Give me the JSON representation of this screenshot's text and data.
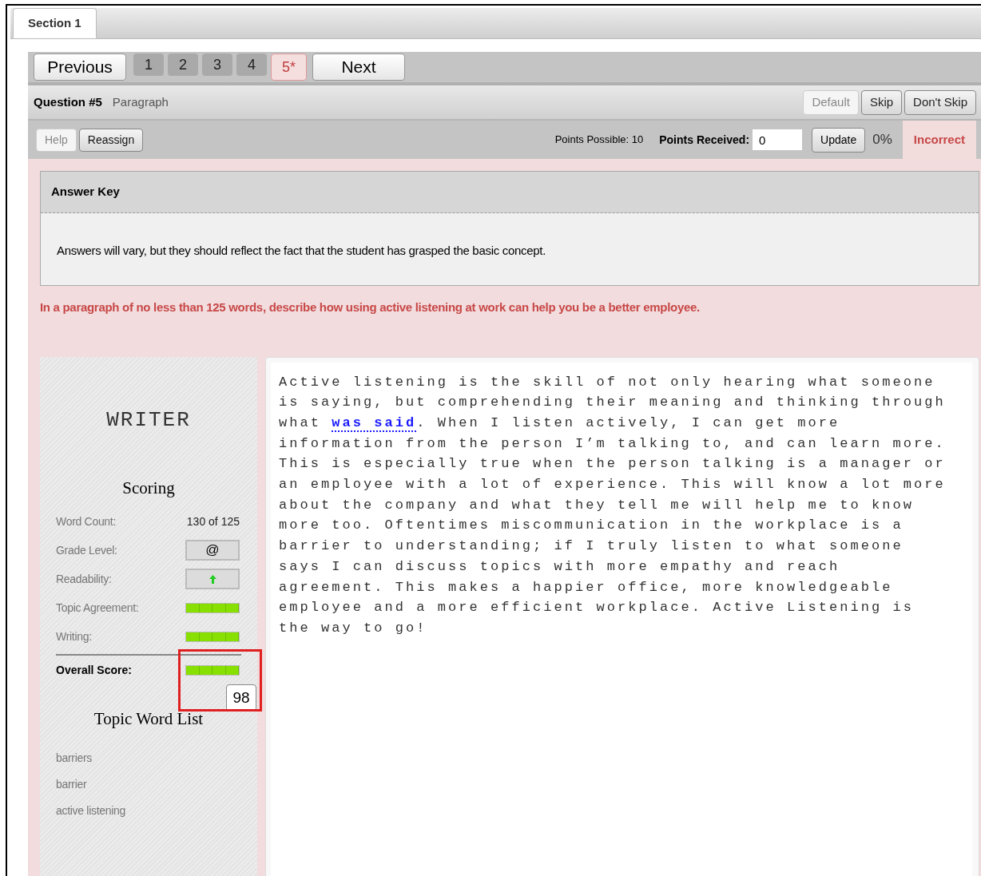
{
  "section_tabs": [
    {
      "label": "Section 1",
      "selected": true
    }
  ],
  "pager": {
    "previous": "Previous",
    "next": "Next",
    "pages": [
      {
        "label": "1",
        "selected": false,
        "flagged": false
      },
      {
        "label": "2",
        "selected": false,
        "flagged": false
      },
      {
        "label": "3",
        "selected": false,
        "flagged": false
      },
      {
        "label": "4",
        "selected": false,
        "flagged": false
      },
      {
        "label": "5*",
        "selected": true,
        "flagged": true
      }
    ]
  },
  "question": {
    "number": "Question #5",
    "type": "Paragraph",
    "skip_buttons": [
      {
        "label": "Default",
        "disabled": true
      },
      {
        "label": "Skip",
        "disabled": false
      },
      {
        "label": "Don't Skip",
        "disabled": false
      }
    ]
  },
  "toolbar": {
    "buttons": [
      {
        "label": "Help",
        "disabled": true
      },
      {
        "label": "Reassign",
        "disabled": false
      }
    ],
    "points_possible": "Points Possible: 10",
    "points_received_label": "Points Received:",
    "points_received_value": "0",
    "update": "Update",
    "percent": "0%",
    "status": "Incorrect"
  },
  "answer_key": {
    "title": "Answer Key",
    "text": "Answers will vary, but they should reflect the fact that the student has grasped the basic concept."
  },
  "prompt": "In a paragraph of no less than 125 words, describe how using active listening at work can help you be a better employee.",
  "writer": {
    "title": "WRITER",
    "scoring_title": "Scoring",
    "metrics": [
      {
        "kind": "text",
        "label": "Word Count:",
        "value": "130 of 125"
      },
      {
        "kind": "symbol",
        "label": "Grade Level:",
        "value": "@"
      },
      {
        "kind": "arrow",
        "label": "Readability:"
      },
      {
        "kind": "meter",
        "label": "Topic Agreement:",
        "level": 1
      },
      {
        "kind": "meter",
        "label": "Writing:",
        "level": 1
      }
    ],
    "overall": {
      "label": "Overall Score:",
      "level": 1,
      "score": "98",
      "highlighted": true
    },
    "topic_title": "Topic Word List",
    "topic_words": [
      "barriers",
      "barrier",
      "active listening"
    ]
  },
  "essay": {
    "before": "Active listening is the skill of not only hearing what someone is saying, but comprehending their meaning and thinking through what ",
    "flagged": "was said",
    "after": ". When I listen actively, I can get more information from the person I’m talking to, and can learn more. This is especially true when the person talking is a manager or an employee with a lot of experience. This will know a lot more about the company and what they tell me will help me to know more too. Oftentimes miscommunication in the workplace is a barrier to understanding; if I truly listen to what someone says I can discuss topics with more empathy and reach agreement. This makes a happier office, more knowledgeable employee and a more efficient workplace. Active Listening is the way to go!"
  }
}
